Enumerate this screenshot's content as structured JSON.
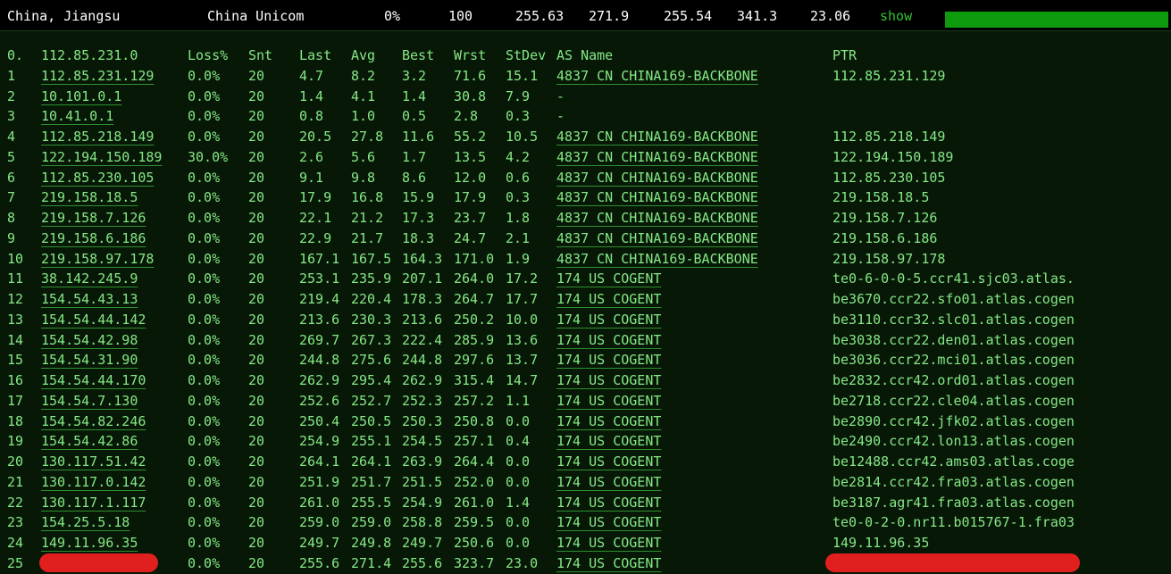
{
  "summary": {
    "location": "China, Jiangsu",
    "isp": "China Unicom",
    "loss": "0%",
    "sent": "100",
    "last": "255.63",
    "avg": "271.9",
    "best": "255.54",
    "worst": "341.3",
    "stdev": "23.06",
    "show_label": "show",
    "bar_level": 1.0,
    "bar_color": "#0e9c0e"
  },
  "table": {
    "header": {
      "hop": "0.",
      "target": "112.85.231.0",
      "loss": "Loss%",
      "snt": "Snt",
      "last": "Last",
      "avg": "Avg",
      "best": "Best",
      "wrst": "Wrst",
      "stdev": "StDev",
      "as_name": "AS Name",
      "ptr": "PTR"
    },
    "rows": [
      {
        "hop": "1",
        "ip": "112.85.231.129",
        "loss": "0.0%",
        "snt": "20",
        "last": "4.7",
        "avg": "8.2",
        "best": "3.2",
        "wrst": "71.6",
        "stdev": "15.1",
        "as_name": "4837  CN CHINA169-BACKBONE",
        "ptr": "112.85.231.129"
      },
      {
        "hop": "2",
        "ip": "10.101.0.1",
        "loss": "0.0%",
        "snt": "20",
        "last": "1.4",
        "avg": "4.1",
        "best": "1.4",
        "wrst": "30.8",
        "stdev": "7.9",
        "as_name": "-",
        "ptr": ""
      },
      {
        "hop": "3",
        "ip": "10.41.0.1",
        "loss": "0.0%",
        "snt": "20",
        "last": "0.8",
        "avg": "1.0",
        "best": "0.5",
        "wrst": "2.8",
        "stdev": "0.3",
        "as_name": "-",
        "ptr": ""
      },
      {
        "hop": "4",
        "ip": "112.85.218.149",
        "loss": "0.0%",
        "snt": "20",
        "last": "20.5",
        "avg": "27.8",
        "best": "11.6",
        "wrst": "55.2",
        "stdev": "10.5",
        "as_name": "4837  CN CHINA169-BACKBONE",
        "ptr": "112.85.218.149"
      },
      {
        "hop": "5",
        "ip": "122.194.150.189",
        "loss": "30.0%",
        "snt": "20",
        "last": "2.6",
        "avg": "5.6",
        "best": "1.7",
        "wrst": "13.5",
        "stdev": "4.2",
        "as_name": "4837  CN CHINA169-BACKBONE",
        "ptr": "122.194.150.189"
      },
      {
        "hop": "6",
        "ip": "112.85.230.105",
        "loss": "0.0%",
        "snt": "20",
        "last": "9.1",
        "avg": "9.8",
        "best": "8.6",
        "wrst": "12.0",
        "stdev": "0.6",
        "as_name": "4837  CN CHINA169-BACKBONE",
        "ptr": "112.85.230.105"
      },
      {
        "hop": "7",
        "ip": "219.158.18.5",
        "loss": "0.0%",
        "snt": "20",
        "last": "17.9",
        "avg": "16.8",
        "best": "15.9",
        "wrst": "17.9",
        "stdev": "0.3",
        "as_name": "4837  CN CHINA169-BACKBONE",
        "ptr": "219.158.18.5"
      },
      {
        "hop": "8",
        "ip": "219.158.7.126",
        "loss": "0.0%",
        "snt": "20",
        "last": "22.1",
        "avg": "21.2",
        "best": "17.3",
        "wrst": "23.7",
        "stdev": "1.8",
        "as_name": "4837  CN CHINA169-BACKBONE",
        "ptr": "219.158.7.126"
      },
      {
        "hop": "9",
        "ip": "219.158.6.186",
        "loss": "0.0%",
        "snt": "20",
        "last": "22.9",
        "avg": "21.7",
        "best": "18.3",
        "wrst": "24.7",
        "stdev": "2.1",
        "as_name": "4837  CN CHINA169-BACKBONE",
        "ptr": "219.158.6.186"
      },
      {
        "hop": "10",
        "ip": "219.158.97.178",
        "loss": "0.0%",
        "snt": "20",
        "last": "167.1",
        "avg": "167.5",
        "best": "164.3",
        "wrst": "171.0",
        "stdev": "1.9",
        "as_name": "4837  CN CHINA169-BACKBONE",
        "ptr": "219.158.97.178"
      },
      {
        "hop": "11",
        "ip": "38.142.245.9",
        "loss": "0.0%",
        "snt": "20",
        "last": "253.1",
        "avg": "235.9",
        "best": "207.1",
        "wrst": "264.0",
        "stdev": "17.2",
        "as_name": "174   US COGENT",
        "ptr": "te0-6-0-0-5.ccr41.sjc03.atlas."
      },
      {
        "hop": "12",
        "ip": "154.54.43.13",
        "loss": "0.0%",
        "snt": "20",
        "last": "219.4",
        "avg": "220.4",
        "best": "178.3",
        "wrst": "264.7",
        "stdev": "17.7",
        "as_name": "174   US COGENT",
        "ptr": "be3670.ccr22.sfo01.atlas.cogen"
      },
      {
        "hop": "13",
        "ip": "154.54.44.142",
        "loss": "0.0%",
        "snt": "20",
        "last": "213.6",
        "avg": "230.3",
        "best": "213.6",
        "wrst": "250.2",
        "stdev": "10.0",
        "as_name": "174   US COGENT",
        "ptr": "be3110.ccr32.slc01.atlas.cogen"
      },
      {
        "hop": "14",
        "ip": "154.54.42.98",
        "loss": "0.0%",
        "snt": "20",
        "last": "269.7",
        "avg": "267.3",
        "best": "222.4",
        "wrst": "285.9",
        "stdev": "13.6",
        "as_name": "174   US COGENT",
        "ptr": "be3038.ccr22.den01.atlas.cogen"
      },
      {
        "hop": "15",
        "ip": "154.54.31.90",
        "loss": "0.0%",
        "snt": "20",
        "last": "244.8",
        "avg": "275.6",
        "best": "244.8",
        "wrst": "297.6",
        "stdev": "13.7",
        "as_name": "174   US COGENT",
        "ptr": "be3036.ccr22.mci01.atlas.cogen"
      },
      {
        "hop": "16",
        "ip": "154.54.44.170",
        "loss": "0.0%",
        "snt": "20",
        "last": "262.9",
        "avg": "295.4",
        "best": "262.9",
        "wrst": "315.4",
        "stdev": "14.7",
        "as_name": "174   US COGENT",
        "ptr": "be2832.ccr42.ord01.atlas.cogen"
      },
      {
        "hop": "17",
        "ip": "154.54.7.130",
        "loss": "0.0%",
        "snt": "20",
        "last": "252.6",
        "avg": "252.7",
        "best": "252.3",
        "wrst": "257.2",
        "stdev": "1.1",
        "as_name": "174   US COGENT",
        "ptr": "be2718.ccr22.cle04.atlas.cogen"
      },
      {
        "hop": "18",
        "ip": "154.54.82.246",
        "loss": "0.0%",
        "snt": "20",
        "last": "250.4",
        "avg": "250.5",
        "best": "250.3",
        "wrst": "250.8",
        "stdev": "0.0",
        "as_name": "174   US COGENT",
        "ptr": "be2890.ccr42.jfk02.atlas.cogen"
      },
      {
        "hop": "19",
        "ip": "154.54.42.86",
        "loss": "0.0%",
        "snt": "20",
        "last": "254.9",
        "avg": "255.1",
        "best": "254.5",
        "wrst": "257.1",
        "stdev": "0.4",
        "as_name": "174   US COGENT",
        "ptr": "be2490.ccr42.lon13.atlas.cogen"
      },
      {
        "hop": "20",
        "ip": "130.117.51.42",
        "loss": "0.0%",
        "snt": "20",
        "last": "264.1",
        "avg": "264.1",
        "best": "263.9",
        "wrst": "264.4",
        "stdev": "0.0",
        "as_name": "174   US COGENT",
        "ptr": "be12488.ccr42.ams03.atlas.coge"
      },
      {
        "hop": "21",
        "ip": "130.117.0.142",
        "loss": "0.0%",
        "snt": "20",
        "last": "251.9",
        "avg": "251.7",
        "best": "251.5",
        "wrst": "252.0",
        "stdev": "0.0",
        "as_name": "174   US COGENT",
        "ptr": "be2814.ccr42.fra03.atlas.cogen"
      },
      {
        "hop": "22",
        "ip": "130.117.1.117",
        "loss": "0.0%",
        "snt": "20",
        "last": "261.0",
        "avg": "255.5",
        "best": "254.9",
        "wrst": "261.0",
        "stdev": "1.4",
        "as_name": "174   US COGENT",
        "ptr": "be3187.agr41.fra03.atlas.cogen"
      },
      {
        "hop": "23",
        "ip": "154.25.5.18",
        "loss": "0.0%",
        "snt": "20",
        "last": "259.0",
        "avg": "259.0",
        "best": "258.8",
        "wrst": "259.5",
        "stdev": "0.0",
        "as_name": "174   US COGENT",
        "ptr": "te0-0-2-0.nr11.b015767-1.fra03"
      },
      {
        "hop": "24",
        "ip": "149.11.96.35",
        "loss": "0.0%",
        "snt": "20",
        "last": "249.7",
        "avg": "249.8",
        "best": "249.7",
        "wrst": "250.6",
        "stdev": "0.0",
        "as_name": "174   US COGENT",
        "ptr": "149.11.96.35"
      },
      {
        "hop": "25",
        "ip": "",
        "loss": "0.0%",
        "snt": "20",
        "last": "255.6",
        "avg": "271.4",
        "best": "255.6",
        "wrst": "323.7",
        "stdev": "23.0",
        "as_name": "174   US COGENT",
        "ptr": "",
        "redacted": true
      }
    ]
  },
  "colors": {
    "background": "#071807",
    "text": "#86e886",
    "redaction": "#e21f1f"
  }
}
